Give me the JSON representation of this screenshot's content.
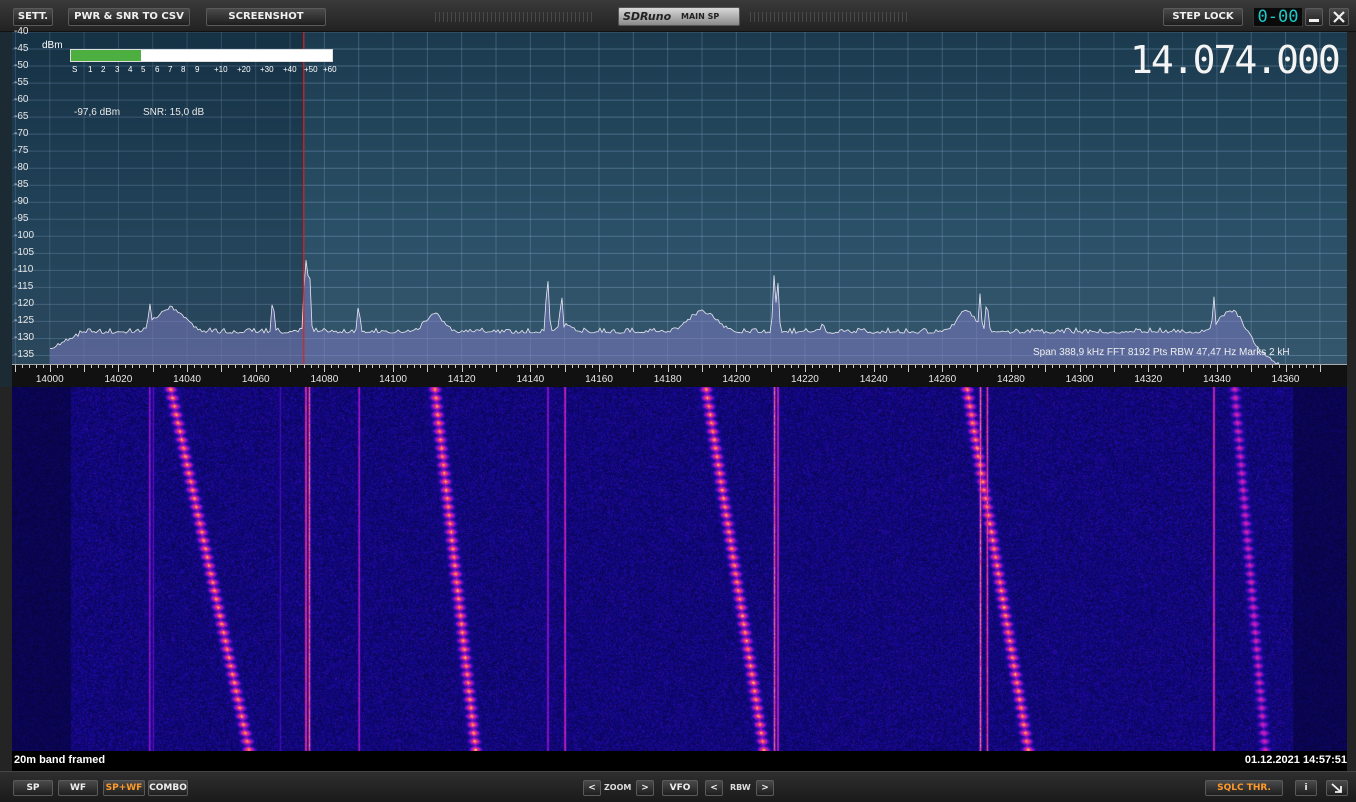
{
  "toolbar": {
    "settings_label": "SETT.",
    "csv_label": "PWR & SNR TO CSV",
    "screenshot_label": "SCREENSHOT",
    "app_logo": "SDRuno",
    "window_name": "MAIN SP",
    "step_lock_label": "STEP LOCK",
    "led_display": "0-00",
    "minimize_icon": "minimize-icon",
    "close_icon": "close-icon"
  },
  "spectrum": {
    "unit_label": "dBm",
    "y_ticks": [
      "-40",
      "-45",
      "-50",
      "-55",
      "-60",
      "-65",
      "-70",
      "-75",
      "-80",
      "-85",
      "-90",
      "-95",
      "-100",
      "-105",
      "-110",
      "-115",
      "-120",
      "-125",
      "-130",
      "-135"
    ],
    "smeter_labels": [
      "S",
      "1",
      "2",
      "3",
      "4",
      "5",
      "6",
      "7",
      "8",
      "9",
      "+10",
      "+20",
      "+30",
      "+40",
      "+50",
      "+60"
    ],
    "smeter_level_fraction": 0.27,
    "level_readout": "-97,6 dBm",
    "snr_readout": "SNR: 15,0 dB",
    "frequency": "14.074.000",
    "info": "Span 388,9 kHz   FFT 8192 Pts   RBW 47,47 Hz   Marks 2 kH"
  },
  "xaxis": {
    "labels": [
      "14000",
      "14020",
      "14040",
      "14060",
      "14080",
      "14100",
      "14120",
      "14140",
      "14160",
      "14180",
      "14200",
      "14220",
      "14240",
      "14260",
      "14280",
      "14300",
      "14320",
      "14340",
      "14360"
    ]
  },
  "waterfall": {
    "caption": "20m band framed",
    "timestamp": "01.12.2021 14:57:51"
  },
  "bottombar": {
    "sp_label": "SP",
    "wf_label": "WF",
    "spwf_label": "SP+WF",
    "combo_label": "COMBO",
    "zoom_label": "ZOOM",
    "vfo_label": "VFO",
    "rbw_label": "RBW",
    "prev_glyph": "<",
    "next_glyph": ">",
    "sqlc_label": "SQLC THR.",
    "info_label": "i",
    "resize_icon": "resize-grip-icon"
  },
  "colors": {
    "spectrum_bg": "#24485e",
    "trace": "#e8e8f0",
    "tuning_line": "#e02020",
    "smeter_fill": "#4caf3f",
    "led": "#1fc8c8",
    "active_button": "#ff9a2a"
  }
}
